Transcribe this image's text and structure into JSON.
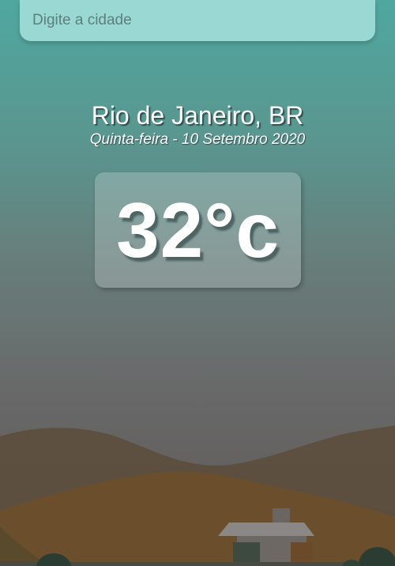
{
  "search": {
    "placeholder": "Digite a cidade"
  },
  "location": {
    "city": "Rio de Janeiro, BR",
    "date": "Quinta-feira - 10 Setembro 2020"
  },
  "weather": {
    "temperature": "32°c"
  },
  "colors": {
    "accent": "#9ad9d3",
    "hill_far": "#5b4a36",
    "hill_near": "#6b4f2c"
  }
}
